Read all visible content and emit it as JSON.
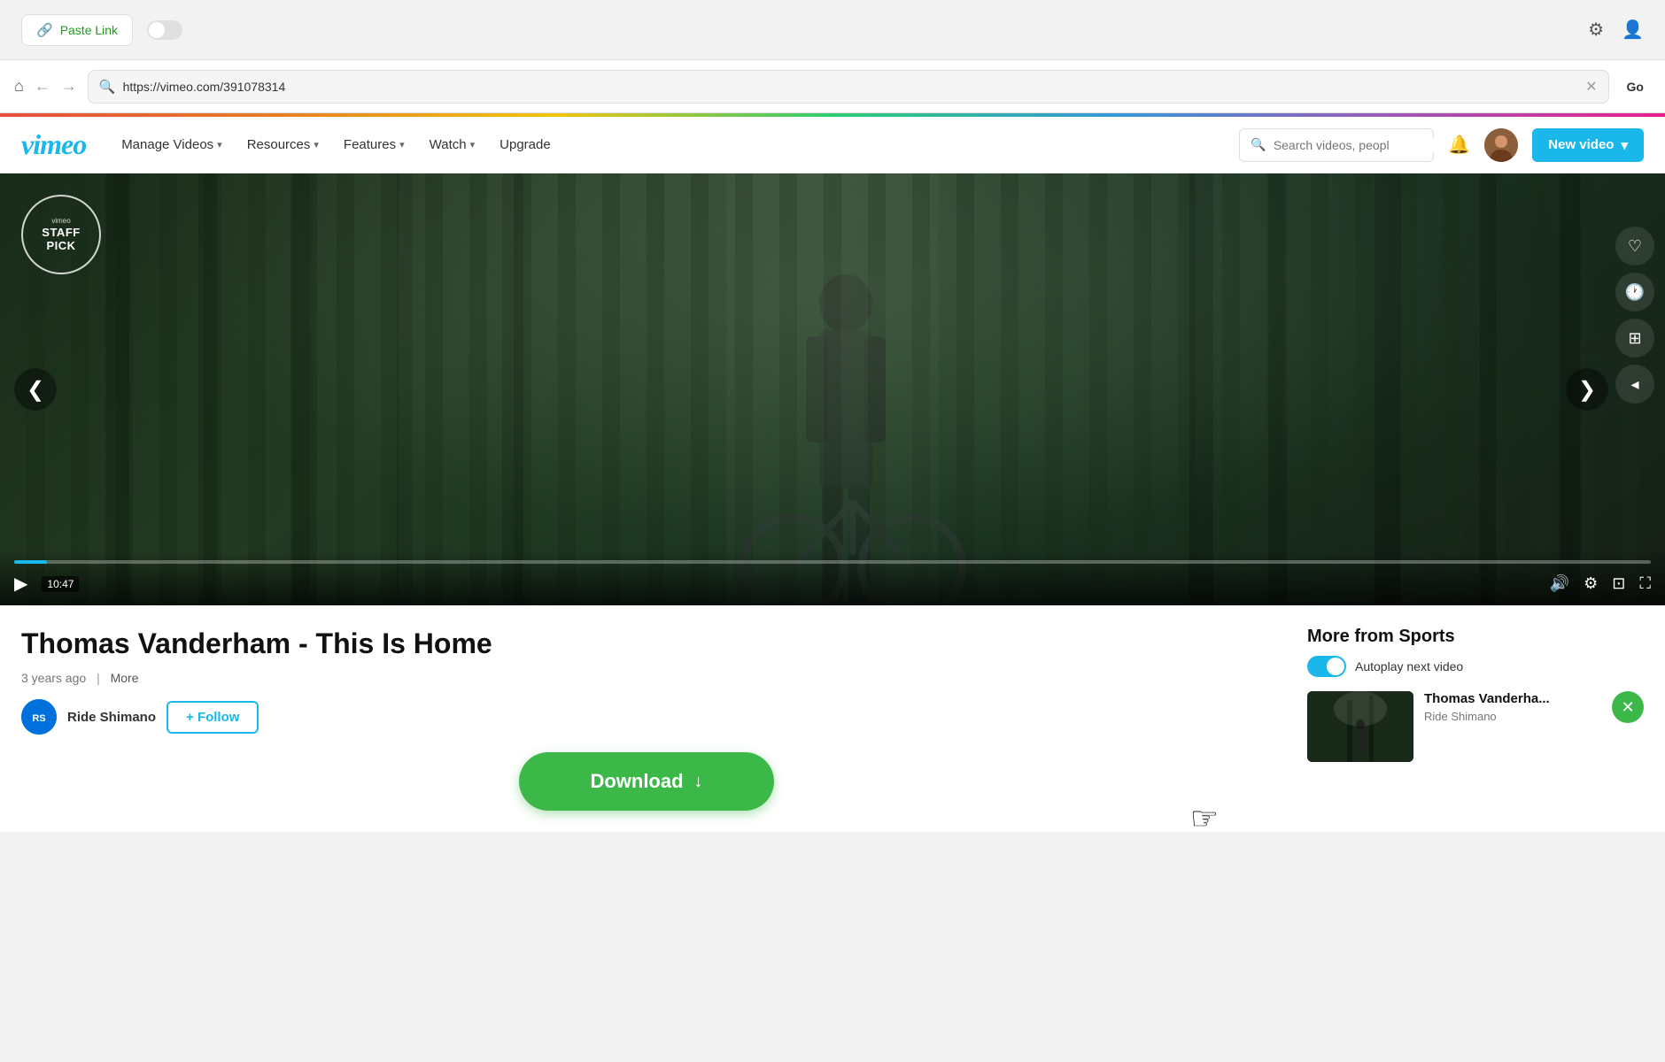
{
  "topbar": {
    "paste_link_label": "Paste Link",
    "settings_icon": "⚙",
    "profile_icon": "👤"
  },
  "browser": {
    "url": "https://vimeo.com/391078314",
    "go_label": "Go",
    "home_icon": "⌂",
    "back_icon": "←",
    "forward_icon": "→",
    "close_icon": "✕",
    "search_icon": "🔍"
  },
  "nav": {
    "logo": "vimeo",
    "manage_videos": "Manage Videos",
    "resources": "Resources",
    "features": "Features",
    "watch": "Watch",
    "upgrade": "Upgrade",
    "search_placeholder": "Search videos, peopl",
    "bell_icon": "🔔",
    "new_video_label": "New video",
    "new_video_chevron": "▾"
  },
  "video": {
    "staff_pick_label": "STAFF PICK",
    "vimeo_label": "vimeo",
    "time": "10:47",
    "prev_icon": "❮",
    "next_icon": "❯",
    "like_icon": "♡",
    "watch_later_icon": "🕐",
    "collections_icon": "⊞",
    "share_icon": "◂",
    "play_icon": "▶",
    "volume_icon": "🔊",
    "settings_icon": "⚙",
    "captions_icon": "⊡",
    "fullscreen_icon": "⛶"
  },
  "info": {
    "title": "Thomas Vanderham - This Is Home",
    "age": "3 years ago",
    "more": "More",
    "channel_name": "Ride Shimano",
    "channel_initials": "RS",
    "follow_label": "+ Follow",
    "download_label": "Download",
    "download_icon": "↓"
  },
  "sidebar": {
    "title": "More from Sports",
    "autoplay_label": "Autoplay next video",
    "next_title": "Thomas Vanderha...",
    "next_channel": "Ride Shimano",
    "close_icon": "✕"
  }
}
